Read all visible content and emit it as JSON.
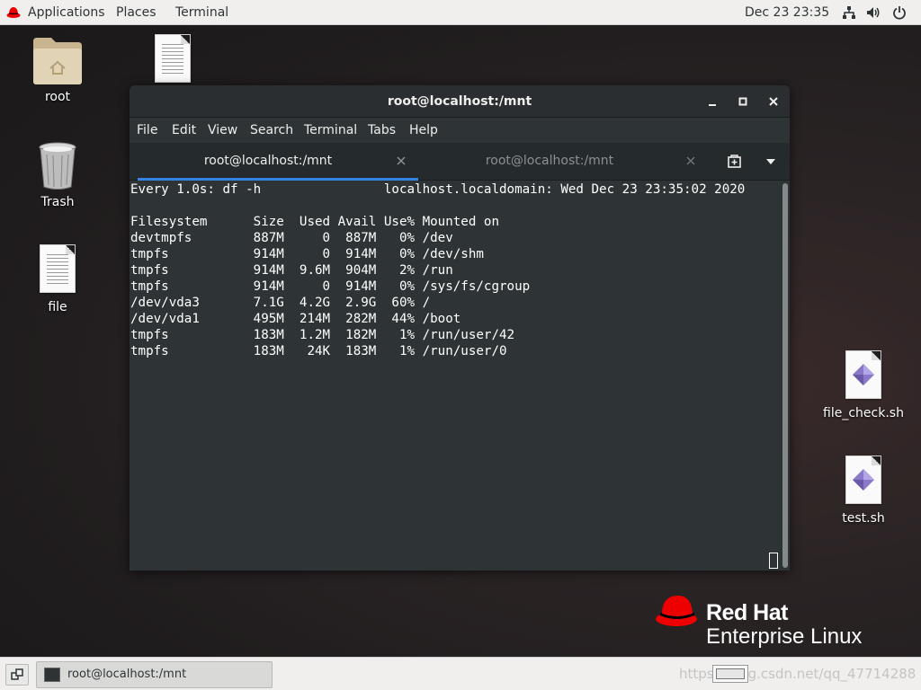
{
  "topbar": {
    "applications": "Applications",
    "places": "Places",
    "terminal": "Terminal",
    "datetime": "Dec 23  23:35",
    "icons": [
      "network-icon",
      "volume-icon",
      "power-icon"
    ]
  },
  "desktop": {
    "icons": [
      {
        "label": "root",
        "icon": "home-folder-icon"
      },
      {
        "label": "Trash",
        "icon": "trash-icon"
      },
      {
        "label": "file",
        "icon": "text-file-icon"
      },
      {
        "label": "",
        "icon": "text-file-icon"
      },
      {
        "label": "file_check.sh",
        "icon": "script-file-icon"
      },
      {
        "label": "test.sh",
        "icon": "script-file-icon"
      }
    ]
  },
  "terminal_window": {
    "title": "root@localhost:/mnt",
    "menu": [
      "File",
      "Edit",
      "View",
      "Search",
      "Terminal",
      "Tabs",
      "Help"
    ],
    "tabs": [
      {
        "label": "root@localhost:/mnt",
        "active": true
      },
      {
        "label": "root@localhost:/mnt",
        "active": false
      }
    ],
    "lines": [
      "Every 1.0s: df -h                localhost.localdomain: Wed Dec 23 23:35:02 2020",
      "",
      "Filesystem      Size  Used Avail Use% Mounted on",
      "devtmpfs        887M     0  887M   0% /dev",
      "tmpfs           914M     0  914M   0% /dev/shm",
      "tmpfs           914M  9.6M  904M   2% /run",
      "tmpfs           914M     0  914M   0% /sys/fs/cgroup",
      "/dev/vda3       7.1G  4.2G  2.9G  60% /",
      "/dev/vda1       495M  214M  282M  44% /boot",
      "tmpfs           183M  1.2M  182M   1% /run/user/42",
      "tmpfs           183M   24K  183M   1% /run/user/0"
    ]
  },
  "branding": {
    "name": "Red Hat",
    "product": "Enterprise Linux",
    "brand_color": "#ee0000"
  },
  "taskbar": {
    "task_label": "root@localhost:/mnt",
    "watermark": "https://blog.csdn.net/qq_47714288"
  }
}
